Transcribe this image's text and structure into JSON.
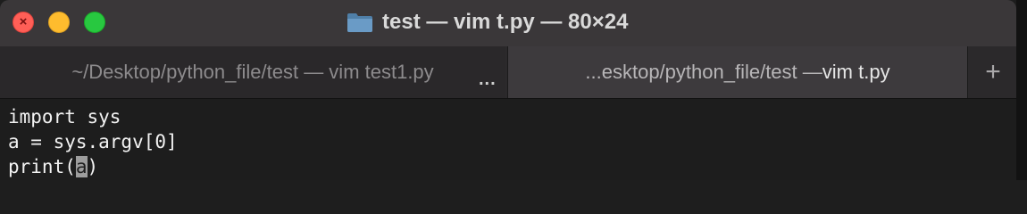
{
  "window": {
    "title": "test — vim t.py — 80×24",
    "folder_icon": "folder-icon",
    "traffic_lights": {
      "close": "#ff5f57",
      "minimize": "#febc2e",
      "maximize": "#28c840"
    }
  },
  "tabs": [
    {
      "label": "~/Desktop/python_file/test — vim test1.py",
      "active": false
    },
    {
      "label_prefix": "...esktop/python_file/test — ",
      "label_emph": "vim t.py",
      "active": true
    }
  ],
  "tab_overflow": "...",
  "new_tab_label": "+",
  "terminal": {
    "lines": [
      "import sys",
      "a = sys.argv[0]"
    ],
    "cursor_line_before": "print(",
    "cursor_char": "a",
    "cursor_line_after": ")"
  }
}
